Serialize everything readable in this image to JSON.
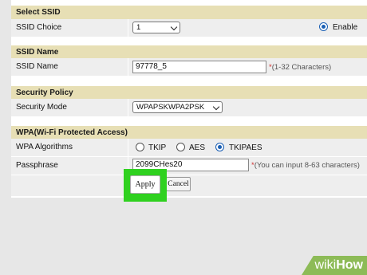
{
  "select_ssid": {
    "heading": "Select SSID",
    "ssid_choice_label": "SSID Choice",
    "ssid_choice_value": "1",
    "enable_label": "Enable"
  },
  "ssid": {
    "heading": "SSID Name",
    "label": "SSID Name",
    "value": "97778_5",
    "hint": "(1-32 Characters)"
  },
  "security_policy": {
    "heading": "Security Policy",
    "mode_label": "Security Mode",
    "mode_value": "WPAPSKWPA2PSK"
  },
  "wpa": {
    "heading": "WPA(Wi-Fi Protected Access)",
    "algorithms_label": "WPA Algorithms",
    "options": [
      "TKIP",
      "AES",
      "TKIPAES"
    ],
    "selected_option": "TKIPAES",
    "passphrase_label": "Passphrase",
    "passphrase_value": "2099CHes20",
    "passphrase_hint": "(You can input 8-63 characters)"
  },
  "buttons": {
    "apply": "Apply",
    "cancel": "Cancel"
  },
  "required_mark": "*",
  "watermark": {
    "part1": "wiki",
    "part2": "How"
  },
  "colors": {
    "section_header": "#e7dfb5",
    "row_background": "#eeeeee",
    "highlight_ring": "#2fd11f",
    "radio_selected": "#1a5fb4",
    "hint_asterisk": "#d03030",
    "watermark_bg": "#8dbb57"
  }
}
